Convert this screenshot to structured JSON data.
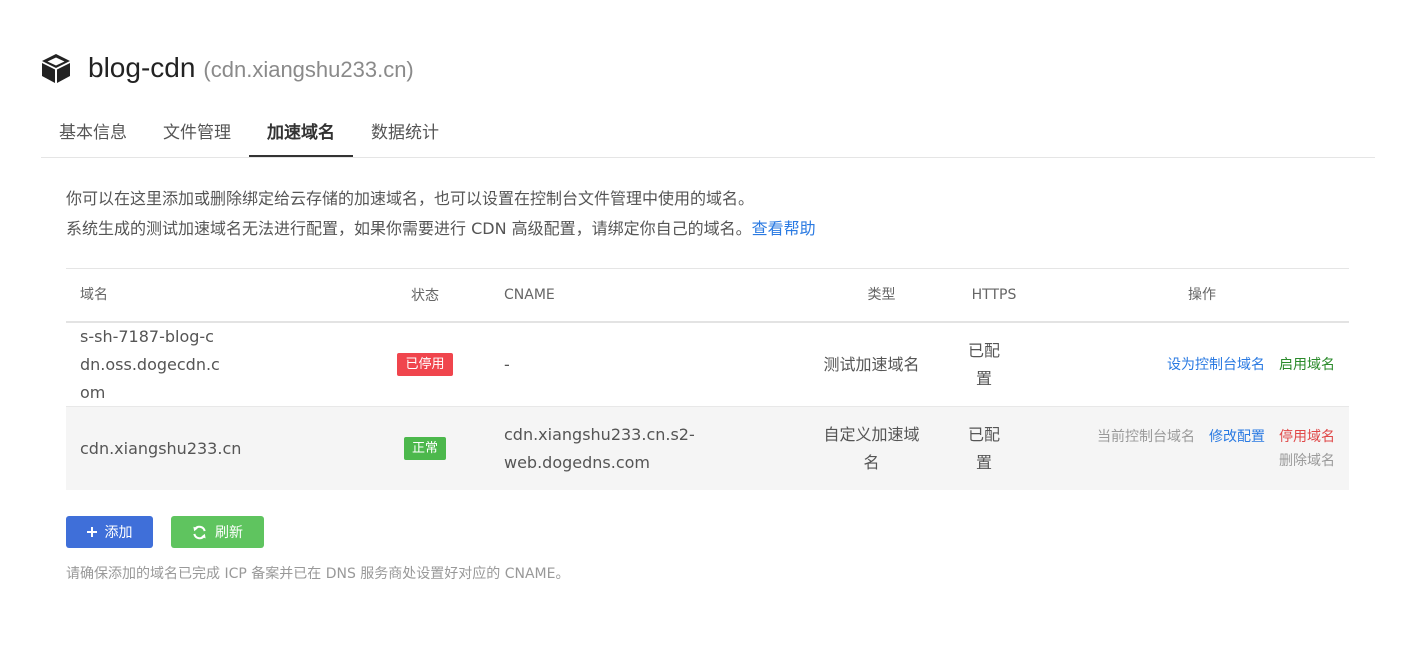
{
  "header": {
    "icon": "box-icon",
    "title": "blog-cdn",
    "subtitle": "(cdn.xiangshu233.cn)"
  },
  "tabs": [
    {
      "label": "基本信息",
      "active": false
    },
    {
      "label": "文件管理",
      "active": false
    },
    {
      "label": "加速域名",
      "active": true
    },
    {
      "label": "数据统计",
      "active": false
    }
  ],
  "description": {
    "line1": "你可以在这里添加或删除绑定给云存储的加速域名，也可以设置在控制台文件管理中使用的域名。",
    "line2": "系统生成的测试加速域名无法进行配置，如果你需要进行 CDN 高级配置，请绑定你自己的域名。",
    "help_link": "查看帮助"
  },
  "table": {
    "headers": {
      "domain": "域名",
      "status": "状态",
      "cname": "CNAME",
      "type": "类型",
      "https": "HTTPS",
      "ops": "操作"
    },
    "rows": [
      {
        "domain": "s-sh-7187-blog-cdn.oss.dogecdn.com",
        "status": "已停用",
        "status_color": "#f0454d",
        "cname": "-",
        "type": "测试加速域名",
        "https": "已配置",
        "ops": {
          "set_console": "设为控制台域名",
          "enable": "启用域名"
        }
      },
      {
        "domain": "cdn.xiangshu233.cn",
        "status": "正常",
        "status_color": "#4cb84c",
        "cname": "cdn.xiangshu233.cn.s2-web.dogedns.com",
        "type": "自定义加速域名",
        "https": "已配置",
        "ops": {
          "current_console": "当前控制台域名",
          "edit": "修改配置",
          "disable": "停用域名",
          "delete": "删除域名"
        }
      }
    ]
  },
  "buttons": {
    "add": {
      "label": "添加",
      "icon": "plus-icon",
      "color": "#3f6fd9"
    },
    "refresh": {
      "label": "刷新",
      "icon": "refresh-icon",
      "color": "#5fc45f"
    }
  },
  "note": "请确保添加的域名已完成 ICP 备案并已在 DNS 服务商处设置好对应的 CNAME。",
  "colors": {
    "link_blue": "#2a7ae2",
    "enable_green": "#2a8a2a",
    "disable_red": "#e04848"
  }
}
